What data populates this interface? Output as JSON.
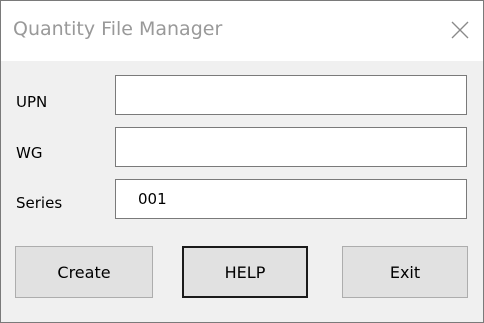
{
  "window": {
    "title": "Quantity File Manager",
    "close_icon": "close-icon"
  },
  "form": {
    "upn": {
      "label": "UPN",
      "value": ""
    },
    "wg": {
      "label": "WG",
      "value": ""
    },
    "series": {
      "label": "Series",
      "value": "001"
    }
  },
  "buttons": {
    "create": "Create",
    "help": "HELP",
    "exit": "Exit"
  }
}
